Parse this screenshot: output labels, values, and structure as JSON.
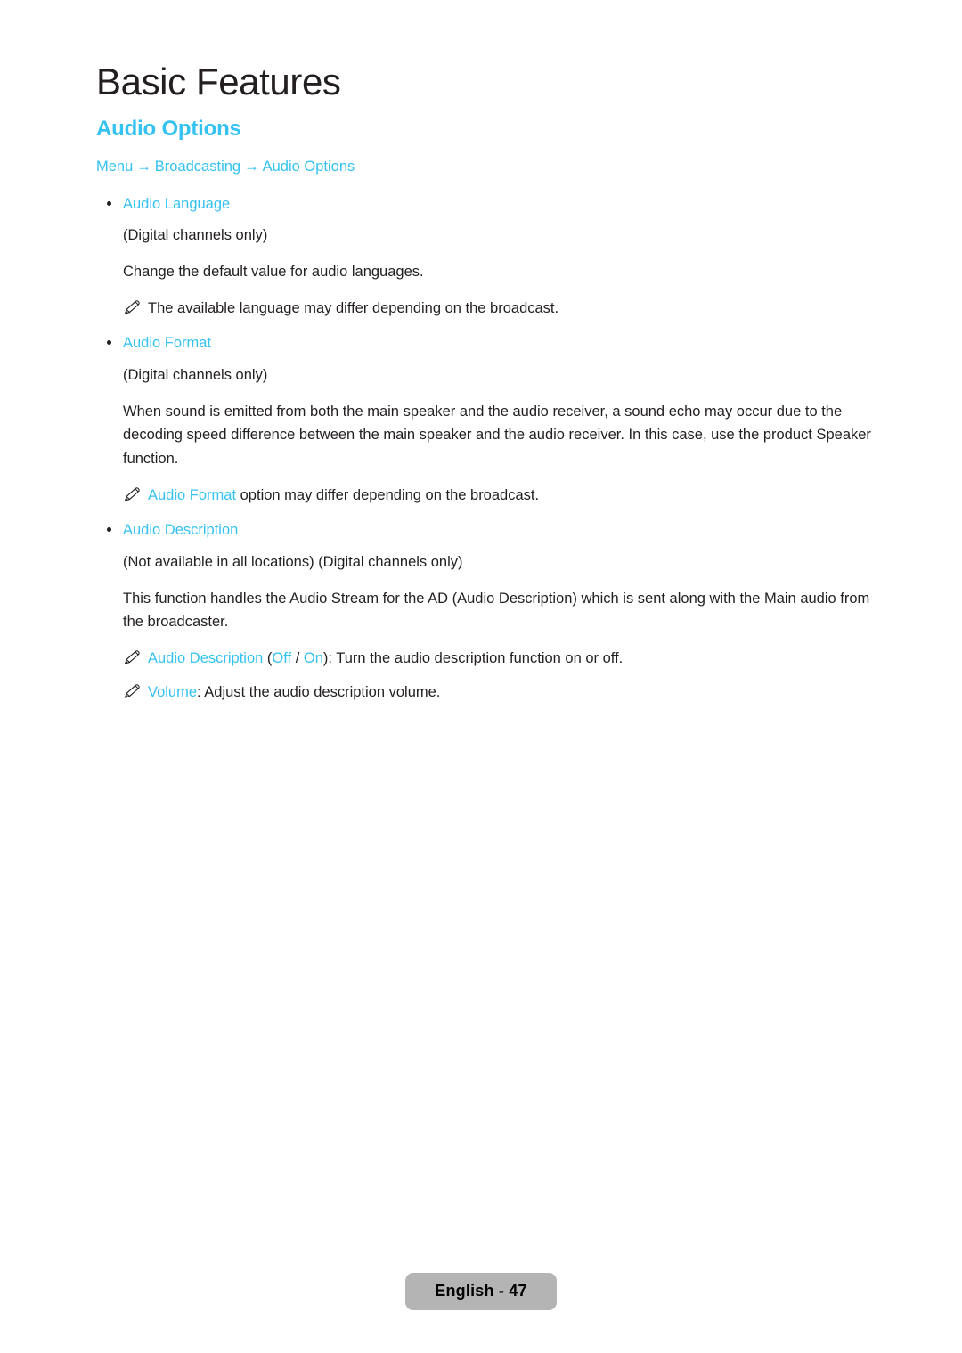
{
  "page": {
    "chapter_title": "Basic Features",
    "section_title": "Audio Options"
  },
  "breadcrumb": {
    "items": [
      "Menu",
      "Broadcasting",
      "Audio Options"
    ],
    "separator": "→"
  },
  "sections": [
    {
      "heading": "Audio Language",
      "note_text": "(Digital channels only)",
      "body": "Change the default value for audio languages.",
      "note": {
        "icon": "pencil-icon",
        "text": "The available language may differ depending on the broadcast."
      }
    },
    {
      "heading": "Audio Format",
      "note_text": "(Digital channels only)",
      "body": "When sound is emitted from both the main speaker and the audio receiver, a sound echo may occur due to the decoding speed difference between the main speaker and the audio receiver. In this case, use the product Speaker function.",
      "note": {
        "icon": "pencil-icon",
        "keyword": "Audio Format",
        "text": " option may differ depending on the broadcast."
      }
    },
    {
      "heading": "Audio Description",
      "note_text": "(Not available in all locations) (Digital channels only)",
      "body": "This function handles the Audio Stream for the AD (Audio Description) which is sent along with the Main audio from the broadcaster.",
      "notes": [
        {
          "icon": "pencil-icon",
          "keyword": "Audio Description",
          "open_paren": " (",
          "option_off": "Off",
          "option_divider": " / ",
          "option_on": "On",
          "close_paren": ")",
          "text": ": Turn the audio description function on or off."
        },
        {
          "icon": "pencil-icon",
          "keyword": "Volume",
          "text": ": Adjust the audio description volume."
        }
      ]
    }
  ],
  "footer": {
    "label": "English - 47"
  },
  "colors": {
    "accent": "#33c2f2",
    "body_text": "#231f20",
    "footer_pill_bg": "#b4b4b4"
  }
}
